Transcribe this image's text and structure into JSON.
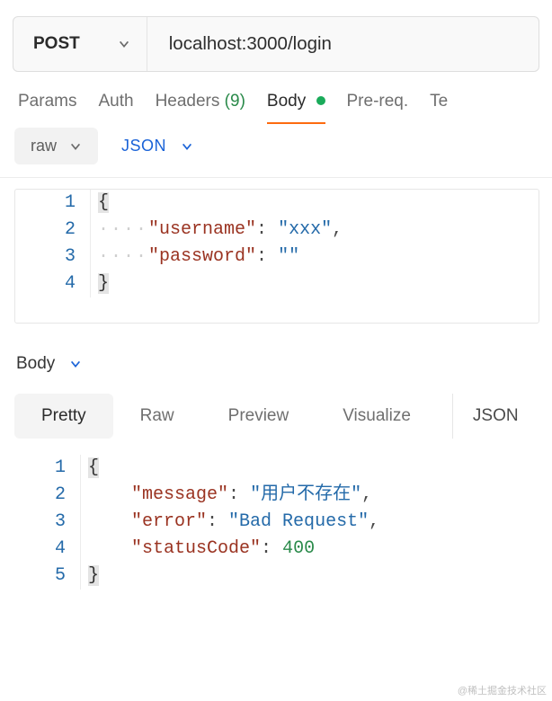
{
  "request": {
    "method": "POST",
    "url": "localhost:3000/login"
  },
  "tabs": {
    "params": "Params",
    "auth": "Auth",
    "headers_label": "Headers",
    "headers_count": "(9)",
    "body": "Body",
    "prereq": "Pre-req.",
    "tests": "Te"
  },
  "body_controls": {
    "mode": "raw",
    "format": "JSON"
  },
  "request_body": {
    "lines": [
      "1",
      "2",
      "3",
      "4"
    ],
    "l1_brace": "{",
    "l2_ws": "····",
    "l2_key": "\"username\"",
    "l2_colon": ": ",
    "l2_val": "\"xxx\"",
    "l2_end": ",",
    "l3_ws": "····",
    "l3_key": "\"password\"",
    "l3_colon": ": ",
    "l3_val": "\"\"",
    "l4_brace": "}"
  },
  "response_controls": {
    "section": "Body",
    "pretty": "Pretty",
    "raw": "Raw",
    "preview": "Preview",
    "visualize": "Visualize",
    "format": "JSON"
  },
  "response_body": {
    "lines": [
      "1",
      "2",
      "3",
      "4",
      "5"
    ],
    "l1_brace": "{",
    "indent": "    ",
    "l2_key": "\"message\"",
    "l2_colon": ": ",
    "l2_val": "\"用户不存在\"",
    "l2_end": ",",
    "l3_key": "\"error\"",
    "l3_colon": ": ",
    "l3_val": "\"Bad Request\"",
    "l3_end": ",",
    "l4_key": "\"statusCode\"",
    "l4_colon": ": ",
    "l4_val": "400",
    "l5_brace": "}"
  },
  "watermark": "@稀土掘金技术社区"
}
